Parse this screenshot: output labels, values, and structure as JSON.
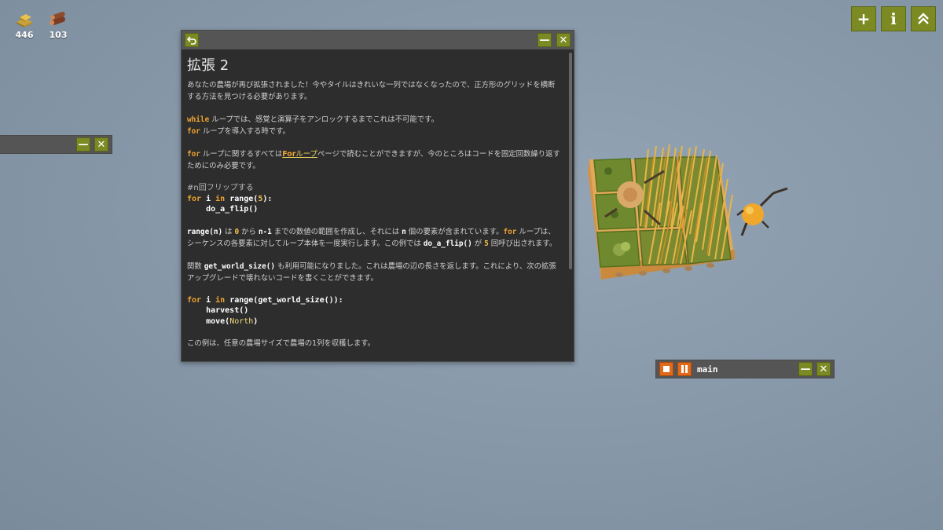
{
  "resources": [
    {
      "icon": "gold-icon",
      "value": "446"
    },
    {
      "icon": "wood-icon",
      "value": "103"
    }
  ],
  "top_buttons": [
    {
      "icon": "plus-icon",
      "label": "+"
    },
    {
      "icon": "info-icon",
      "label": "i"
    },
    {
      "icon": "double-chevron-up-icon",
      "label": ""
    }
  ],
  "docs": {
    "title": "拡張 2",
    "p1": "あなたの農場が再び拡張されました！今やタイルはきれいな一列ではなくなったので、正方形のグリッドを横断する方法を見つける必要があります。",
    "p2_kw": "while",
    "p2_rest": " ループでは、感覚と演算子をアンロックするまでこれは不可能です。",
    "p2b_kw": "for",
    "p2b_rest": " ループを導入する時です。",
    "p3_kw": "for",
    "p3_a": " ループに関するすべては",
    "p3_link_kw": "For",
    "p3_link_rest": "ループ",
    "p3_b": "ページで読むことができますが、今のところはコードを固定回数繰り返すためにのみ必要です。",
    "code1_comment": "#n回フリップする",
    "code1_for": "for",
    "code1_i": " i ",
    "code1_in": "in",
    "code1_range": " range(",
    "code1_num": "5",
    "code1_close": "):",
    "code1_call": "    do_a_flip()",
    "p4_fn": "range(n)",
    "p4_a": " は ",
    "p4_zero": "0",
    "p4_b": " から ",
    "p4_n1": "n-1",
    "p4_c": " までの数値の範囲を作成し、それには ",
    "p4_n": "n",
    "p4_d": " 個の要素が含まれています。",
    "p4_for": "for",
    "p4_e": " ループは、シーケンスの各要素に対してループ本体を一度実行します。この例では ",
    "p4_call": "do_a_flip()",
    "p4_f": " が ",
    "p4_five": "5",
    "p4_g": " 回呼び出されます。",
    "p5_a": "関数 ",
    "p5_fn": "get_world_size()",
    "p5_b": " も利用可能になりました。これは農場の辺の長さを返します。これにより、次の拡張アップグレードで壊れないコードを書くことができます。",
    "code2_for": "for",
    "code2_i": " i ",
    "code2_in": "in",
    "code2_rest": " range(get_world_size()):",
    "code2_l2": "    harvest()",
    "code2_l3a": "    move(",
    "code2_l3b": "North",
    "code2_l3c": ")",
    "p6": "この例は、任意の農場サイズで農場の1列を収穫します。"
  },
  "main_window": {
    "name": "main"
  },
  "colors": {
    "button_green": "#7b8a22",
    "orange": "#e06a1a",
    "keyword": "#f0a232"
  }
}
